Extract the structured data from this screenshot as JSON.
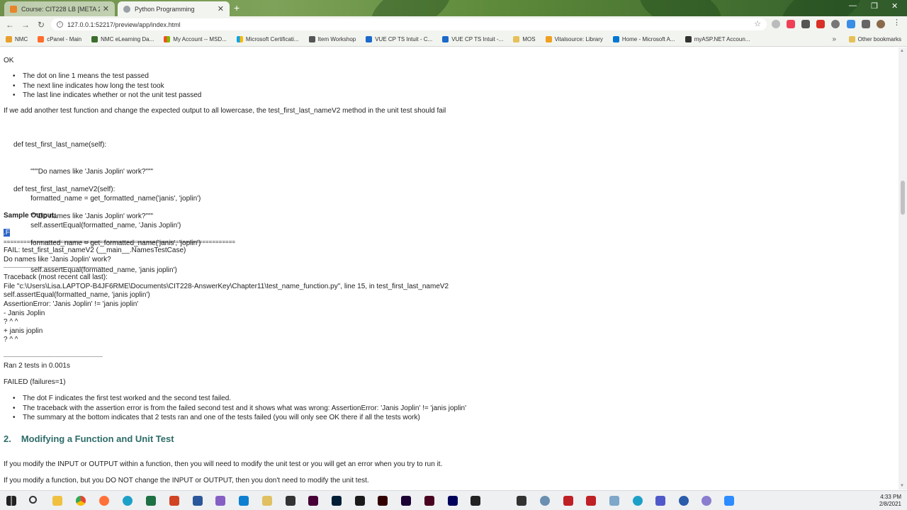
{
  "browser": {
    "tabs": [
      {
        "title": "Course: CIT228 LB [META 2102]",
        "active": false
      },
      {
        "title": "Python Programming",
        "active": true
      }
    ],
    "url": "127.0.0.1:52217/preview/app/index.html",
    "bookmarks": [
      {
        "label": "NMC",
        "icon": "nmc-icon",
        "color": "#e8a02b"
      },
      {
        "label": "cPanel - Main",
        "icon": "cpanel-icon",
        "color": "#ff6c2c"
      },
      {
        "label": "NMC eLearning Da...",
        "icon": "moodle-icon",
        "color": "#3b6e2c"
      },
      {
        "label": "My Account -- MSD...",
        "icon": "microsoft-icon",
        "color": "#f25022"
      },
      {
        "label": "Microsoft Certificati...",
        "icon": "microsoft-icon",
        "color": "#7fba00"
      },
      {
        "label": "Item Workshop",
        "icon": "workshop-icon",
        "color": "#555555"
      },
      {
        "label": "VUE CP TS Intuit - C...",
        "icon": "vue-icon",
        "color": "#1b6ac9"
      },
      {
        "label": "VUE CP TS Intuit -...",
        "icon": "vue-icon",
        "color": "#1b6ac9"
      },
      {
        "label": "MOS",
        "icon": "folder-icon",
        "color": "#e6c15a"
      },
      {
        "label": "Vitalsource: Library",
        "icon": "vitalsource-icon",
        "color": "#f0a020"
      },
      {
        "label": "Home - Microsoft A...",
        "icon": "azure-icon",
        "color": "#0078d4"
      },
      {
        "label": "myASP.NET Accoun...",
        "icon": "aspnet-icon",
        "color": "#333333"
      }
    ],
    "other_bookmarks": "Other bookmarks"
  },
  "page": {
    "ok_line": "OK",
    "bullets1": [
      "The dot on line 1 means the test passed",
      "The next line indicates how long the test took",
      "The last line indicates whether or not the unit test passed"
    ],
    "intro2": "If we add another test function and change the expected output to all lowercase, the test_first_last_nameV2 method in the unit test should fail",
    "code1": [
      "def test_first_last_name(self):",
      "    \"\"\"Do names like 'Janis Joplin' work?\"\"\"",
      "    formatted_name = get_formatted_name('janis', 'joplin')",
      "    self.assertEqual(formatted_name, 'Janis Joplin')"
    ],
    "code2": [
      "def test_first_last_nameV2(self):",
      "    \"\"\"Do names like 'Janis Joplin' work?\"\"\"",
      "    formatted_name = get_formatted_name('janis', 'joplin')",
      "    self.assertEqual(formatted_name, 'janis joplin')"
    ],
    "sample_output_label": "Sample Output:",
    "output_first": ".F",
    "double_rule": "======================================================================",
    "fail_line": "FAIL: test_first_last_nameV2 (__main__.NamesTestCase)",
    "fail_doc": "Do names like 'Janis Joplin' work?",
    "single_rule": "----------------------------------------------------------------------",
    "traceback": [
      "Traceback (most recent call last):",
      "File \"c:\\Users\\Lisa.LAPTOP-B4JF6RME\\Documents\\CIT228-AnswerKey\\Chapter11\\test_name_function.py\", line 15, in test_first_last_nameV2",
      "self.assertEqual(formatted_name, 'janis joplin')",
      "AssertionError: 'Janis Joplin' != 'janis joplin'",
      "- Janis Joplin",
      "? ^ ^",
      "+ janis joplin",
      "? ^ ^"
    ],
    "ran_line": "Ran 2 tests in 0.001s",
    "failed_line": "FAILED (failures=1)",
    "bullets2": [
      "The dot F indicates the first test worked and the second test failed.",
      "The traceback with the assertion error is from the failed second test and it shows what was wrong:  AssertionError: 'Janis Joplin' != 'janis joplin'",
      "The summary at the bottom indicates that 2 tests ran and one of the tests failed   (you will only see OK there if all the tests work)"
    ],
    "section_number": "2.",
    "section_title": "Modifying a Function and Unit Test",
    "para_modify1": "If you modify the INPUT or OUTPUT within a function, then you will need to modify the unit test or you will get an error when you try to run it.",
    "para_modify2": "If you modify a function, but you DO NOT change the INPUT or OUTPUT, then you don't need to modify the unit test."
  },
  "taskbar": {
    "time": "4:33 PM",
    "date": "2/8/2021",
    "apps": [
      "file-explorer-icon",
      "chrome-icon",
      "firefox-icon",
      "edge-icon",
      "excel-icon",
      "powerpoint-icon",
      "word-icon",
      "visual-studio-icon",
      "vscode-icon",
      "app-icon",
      "sublime-icon",
      "dreamweaver-icon",
      "photoshop-icon",
      "bridge-icon",
      "illustrator-icon",
      "animate-icon",
      "indesign-icon",
      "after-effects-icon",
      "acrobat-icon",
      "terminal-icon",
      "snipping-icon",
      "filezilla-icon",
      "filezilla-icon",
      "feather-icon",
      "edge-icon",
      "teams-icon",
      "headset-icon",
      "app-icon",
      "zoom-icon"
    ]
  }
}
